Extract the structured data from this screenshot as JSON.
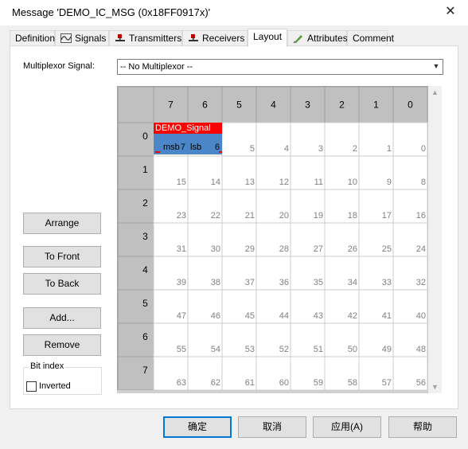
{
  "window": {
    "title": "Message 'DEMO_IC_MSG (0x18FF0917x)'",
    "close_symbol": "✕"
  },
  "tabs": [
    {
      "label": "Definition",
      "icon": ""
    },
    {
      "label": "Signals",
      "icon": "signals-icon"
    },
    {
      "label": "Transmitters",
      "icon": "transmitter-icon"
    },
    {
      "label": "Receivers",
      "icon": "receiver-icon"
    },
    {
      "label": "Layout",
      "icon": ""
    },
    {
      "label": "Attributes",
      "icon": "attributes-icon"
    },
    {
      "label": "Comment",
      "icon": ""
    }
  ],
  "active_tab": "Layout",
  "multiplexor": {
    "label": "Multiplexor Signal:",
    "value": "-- No Multiplexor --"
  },
  "buttons": {
    "arrange": "Arrange",
    "to_front": "To Front",
    "to_back": "To Back",
    "add": "Add...",
    "remove": "Remove"
  },
  "bit_index": {
    "legend": "Bit index",
    "inverted_label": "Inverted",
    "inverted_checked": false
  },
  "layout_grid": {
    "column_headers": [
      "7",
      "6",
      "5",
      "4",
      "3",
      "2",
      "1",
      "0"
    ],
    "row_headers": [
      "0",
      "1",
      "2",
      "3",
      "4",
      "5",
      "6",
      "7"
    ],
    "bit_numbers": [
      [
        "",
        "",
        "5",
        "4",
        "3",
        "2",
        "1",
        "0"
      ],
      [
        "15",
        "14",
        "13",
        "12",
        "11",
        "10",
        "9",
        "8"
      ],
      [
        "23",
        "22",
        "21",
        "20",
        "19",
        "18",
        "17",
        "16"
      ],
      [
        "31",
        "30",
        "29",
        "28",
        "27",
        "26",
        "25",
        "24"
      ],
      [
        "39",
        "38",
        "37",
        "36",
        "35",
        "34",
        "33",
        "32"
      ],
      [
        "47",
        "46",
        "45",
        "44",
        "43",
        "42",
        "41",
        "40"
      ],
      [
        "55",
        "54",
        "53",
        "52",
        "51",
        "50",
        "49",
        "48"
      ],
      [
        "63",
        "62",
        "61",
        "60",
        "59",
        "58",
        "57",
        "56"
      ]
    ],
    "signal": {
      "name": "DEMO_Signal",
      "msb_label": "msb",
      "msb_bit": "7",
      "lsb_label": "lsb",
      "lsb_bit": "6",
      "row": 0,
      "start_col": 0,
      "end_col": 1,
      "name_color": "#ff0000",
      "body_color": "#4a86c8"
    }
  },
  "dialog_buttons": {
    "ok": "确定",
    "cancel": "取消",
    "apply": "应用(A)",
    "help": "帮助"
  }
}
